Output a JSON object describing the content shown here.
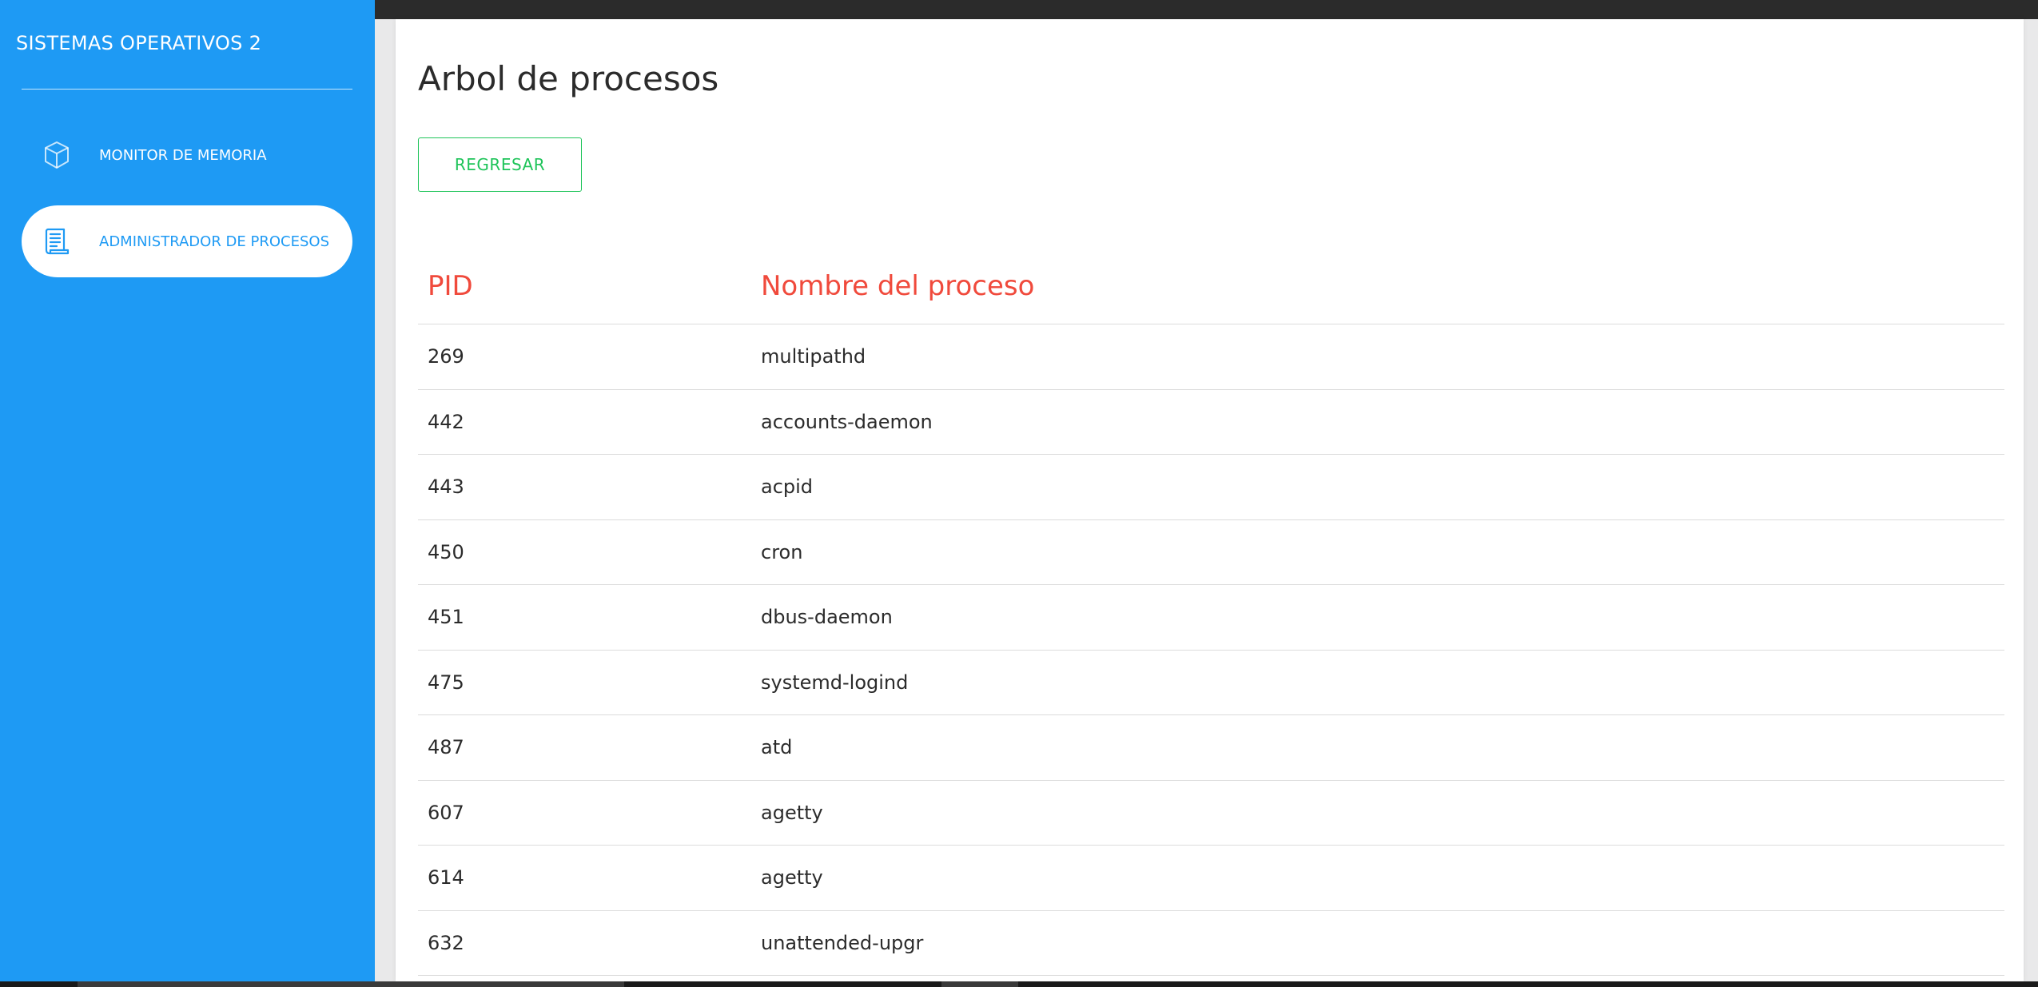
{
  "sidebar": {
    "brand": "SISTEMAS OPERATIVOS 2",
    "items": [
      {
        "label": "MONITOR DE MEMORIA",
        "icon": "cube-icon",
        "active": false
      },
      {
        "label": "ADMINISTRADOR DE PROCESOS",
        "icon": "document-icon",
        "active": true
      }
    ]
  },
  "main": {
    "title": "Arbol de procesos",
    "back_button_label": "REGRESAR",
    "table": {
      "headers": [
        "PID",
        "Nombre del proceso"
      ],
      "rows": [
        {
          "pid": "269",
          "name": "multipathd"
        },
        {
          "pid": "442",
          "name": "accounts-daemon"
        },
        {
          "pid": "443",
          "name": "acpid"
        },
        {
          "pid": "450",
          "name": "cron"
        },
        {
          "pid": "451",
          "name": "dbus-daemon"
        },
        {
          "pid": "475",
          "name": "systemd-logind"
        },
        {
          "pid": "487",
          "name": "atd"
        },
        {
          "pid": "607",
          "name": "agetty"
        },
        {
          "pid": "614",
          "name": "agetty"
        },
        {
          "pid": "632",
          "name": "unattended-upgr"
        }
      ]
    }
  },
  "colors": {
    "sidebar_bg": "#1e9af4",
    "header_text": "#f04a3c",
    "button_accent": "#1fc45a",
    "content_bg": "#e9e9ea"
  }
}
